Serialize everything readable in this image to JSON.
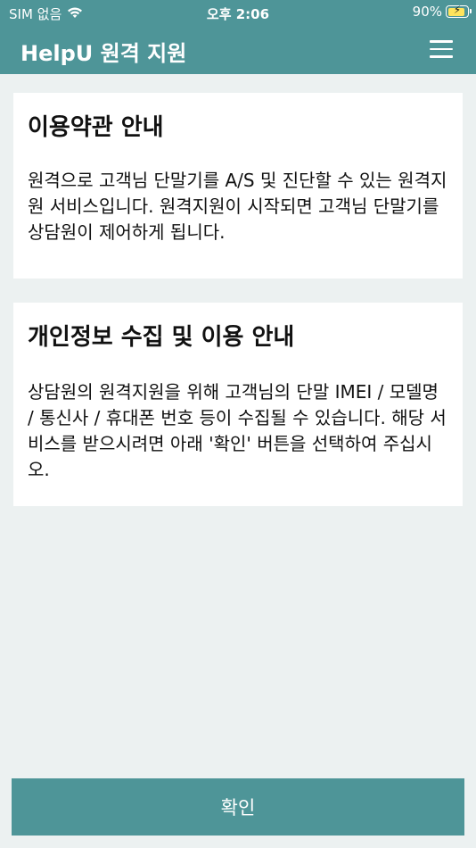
{
  "status_bar": {
    "carrier": "SIM 없음",
    "time": "오후 2:06",
    "battery": "90%",
    "battery_level": 0.9
  },
  "app_bar": {
    "title": "HelpU 원격 지원",
    "menu_icon": "hamburger-menu-icon"
  },
  "terms": {
    "title": "이용약관 안내",
    "body": "원격으로 고객님 단말기를 A/S 및 진단할 수 있는 원격지원 서비스입니다. 원격지원이 시작되면 고객님 단말기를 상담원이 제어하게 됩니다."
  },
  "privacy": {
    "title": "개인정보 수집 및 이용 안내",
    "body": "상담원의 원격지원을 위해 고객님의 단말 IMEI / 모델명 / 통신사 / 휴대폰 번호 등이 수집될 수 있습니다. 해당 서비스를 받으시려면 아래 '확인' 버튼을 선택하여 주십시오."
  },
  "confirm_label": "확인",
  "colors": {
    "primary": "#4e9598",
    "background": "#ecf1f1",
    "card": "#ffffff"
  }
}
